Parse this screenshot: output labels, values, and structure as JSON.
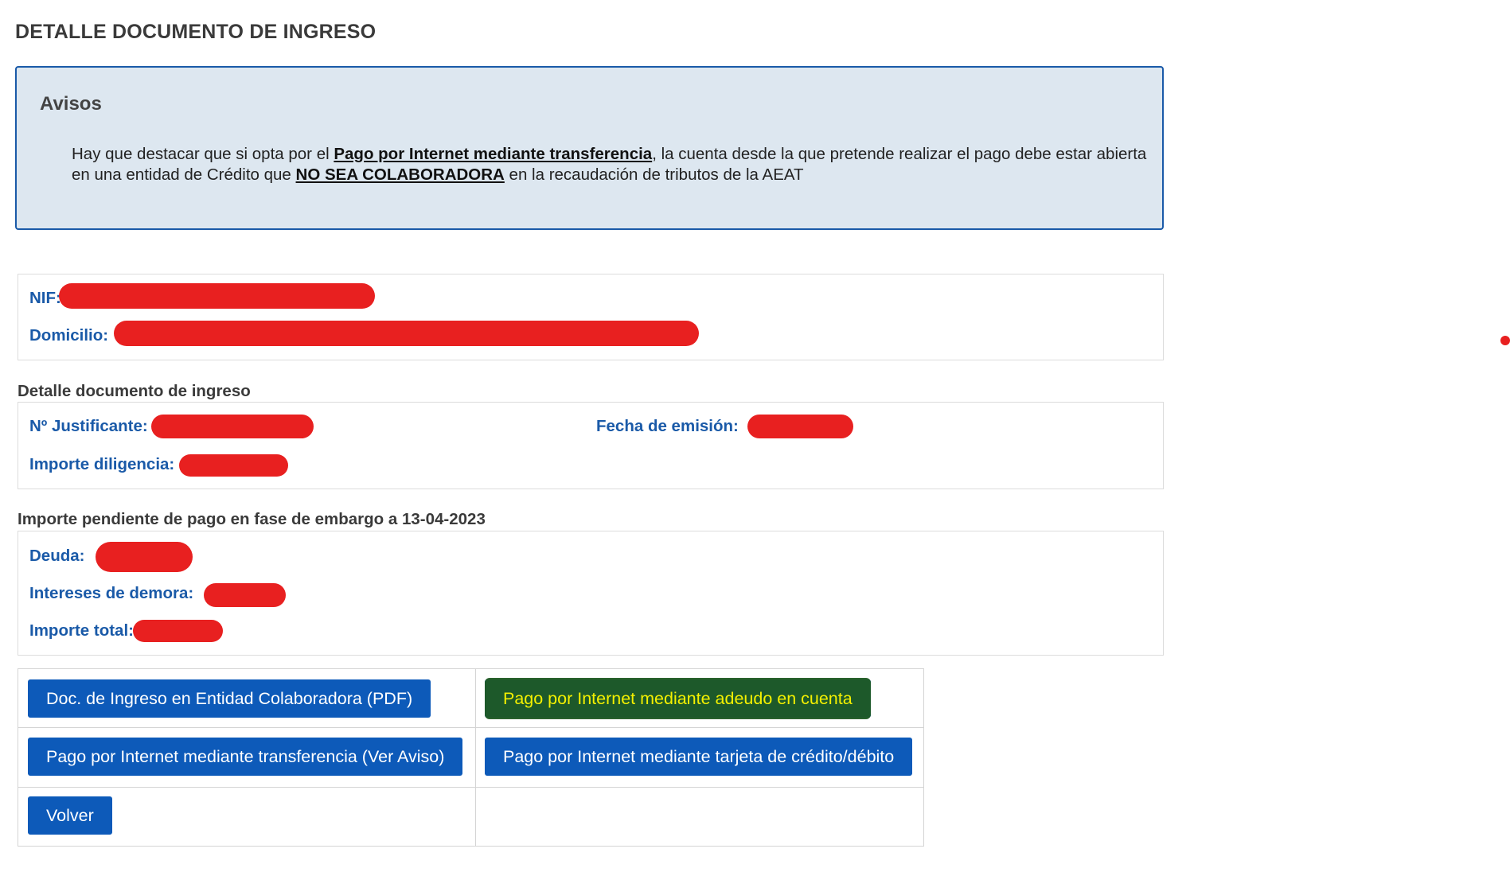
{
  "page": {
    "title": "DETALLE DOCUMENTO DE INGRESO"
  },
  "notice": {
    "title": "Avisos",
    "text_before": "Hay que destacar que si opta por el ",
    "link_transfer": "Pago por Internet mediante transferencia",
    "text_middle": ", la cuenta desde la que pretende realizar el pago debe estar abierta en una entidad de Crédito que ",
    "emphasis": "NO SEA COLABORADORA",
    "text_after": " en la recaudación de tributos de la AEAT"
  },
  "taxpayer": {
    "nif_label": "NIF:",
    "domicilio_label": "Domicilio:"
  },
  "detail": {
    "section_title": "Detalle documento de ingreso",
    "justificante_label": "Nº Justificante:",
    "fecha_label": "Fecha de emisión:",
    "importe_diligencia_label": "Importe diligencia:"
  },
  "pending": {
    "section_title": "Importe pendiente de pago en fase de embargo a 13-04-2023",
    "deuda_label": "Deuda:",
    "intereses_label": "Intereses de demora:",
    "total_label": "Importe total:"
  },
  "buttons": {
    "doc_ingreso": "Doc. de Ingreso en Entidad Colaboradora (PDF)",
    "adeudo": "Pago por Internet mediante adeudo en cuenta",
    "transferencia": "Pago por Internet mediante transferencia (Ver Aviso)",
    "tarjeta": "Pago por Internet mediante tarjeta de crédito/débito",
    "volver": "Volver"
  },
  "colors": {
    "accent_blue": "#0d5ab9",
    "label_blue": "#1a5aa8",
    "notice_bg": "#dde7f0",
    "redaction": "#e82020",
    "highlight_bg": "#1f5a22",
    "highlight_text": "#f4f000"
  }
}
